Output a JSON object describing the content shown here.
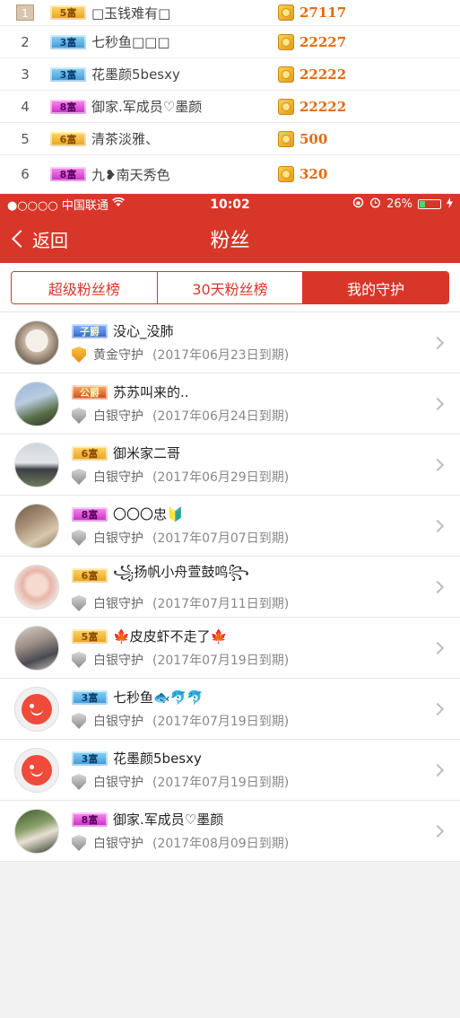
{
  "ranking": [
    {
      "rank": "1",
      "badge": "5富",
      "badge_color": "gold",
      "name": "□玉钱难有□",
      "score": "27117"
    },
    {
      "rank": "2",
      "badge": "3富",
      "badge_color": "blue",
      "name": "七秒鱼□□□",
      "score": "22227"
    },
    {
      "rank": "3",
      "badge": "3富",
      "badge_color": "blue",
      "name": "花墨颜5besxy",
      "score": "22222"
    },
    {
      "rank": "4",
      "badge": "8富",
      "badge_color": "purple",
      "name": "御家.军成员♡墨颜",
      "score": "22222"
    },
    {
      "rank": "5",
      "badge": "6富",
      "badge_color": "gold",
      "name": "清茶淡雅、",
      "score": "500"
    },
    {
      "rank": "6",
      "badge": "8富",
      "badge_color": "purple",
      "name": "九❥南天秀色",
      "score": "320"
    }
  ],
  "status_bar": {
    "carrier": "●○○○○ 中国联通",
    "time": "10:02",
    "battery": "26%"
  },
  "nav": {
    "back_label": "返回",
    "title": "粉丝"
  },
  "tabs": [
    {
      "label": "超级粉丝榜",
      "active": false
    },
    {
      "label": "30天粉丝榜",
      "active": false
    },
    {
      "label": "我的守护",
      "active": true
    }
  ],
  "guards": [
    {
      "badge": "子爵",
      "badge_color": "zi",
      "name": "没心_没肺",
      "shield": "gold",
      "type": "黄金守护",
      "expire": "(2017年06月23日到期)"
    },
    {
      "badge": "公爵",
      "badge_color": "gong",
      "name": "苏苏叫来的..",
      "shield": "silver",
      "type": "白银守护",
      "expire": "(2017年06月24日到期)"
    },
    {
      "badge": "6富",
      "badge_color": "gold",
      "name": "御米家二哥",
      "shield": "silver",
      "type": "白银守护",
      "expire": "(2017年06月29日到期)"
    },
    {
      "badge": "8富",
      "badge_color": "purple",
      "name": "〇〇〇忠🔰",
      "shield": "silver",
      "type": "白银守护",
      "expire": "(2017年07月07日到期)"
    },
    {
      "badge": "6富",
      "badge_color": "gold",
      "name": "꧁扬帆小舟萱鼓鸣꧂",
      "shield": "silver",
      "type": "白银守护",
      "expire": "(2017年07月11日到期)"
    },
    {
      "badge": "5富",
      "badge_color": "gold",
      "name": "🍁皮皮虾不走了🍁",
      "shield": "silver",
      "type": "白银守护",
      "expire": "(2017年07月19日到期)"
    },
    {
      "badge": "3富",
      "badge_color": "blue",
      "name": "七秒鱼🐟🐬🐬",
      "shield": "silver",
      "type": "白银守护",
      "expire": "(2017年07月19日到期)"
    },
    {
      "badge": "3富",
      "badge_color": "blue",
      "name": "花墨颜5besxy",
      "shield": "silver",
      "type": "白银守护",
      "expire": "(2017年07月19日到期)"
    },
    {
      "badge": "8富",
      "badge_color": "purple",
      "name": "御家.军成员♡墨颜",
      "shield": "silver",
      "type": "白银守护",
      "expire": "(2017年08月09日到期)"
    }
  ],
  "colors": {
    "primary_red": "#d9362a",
    "score_orange": "#e36a10"
  }
}
